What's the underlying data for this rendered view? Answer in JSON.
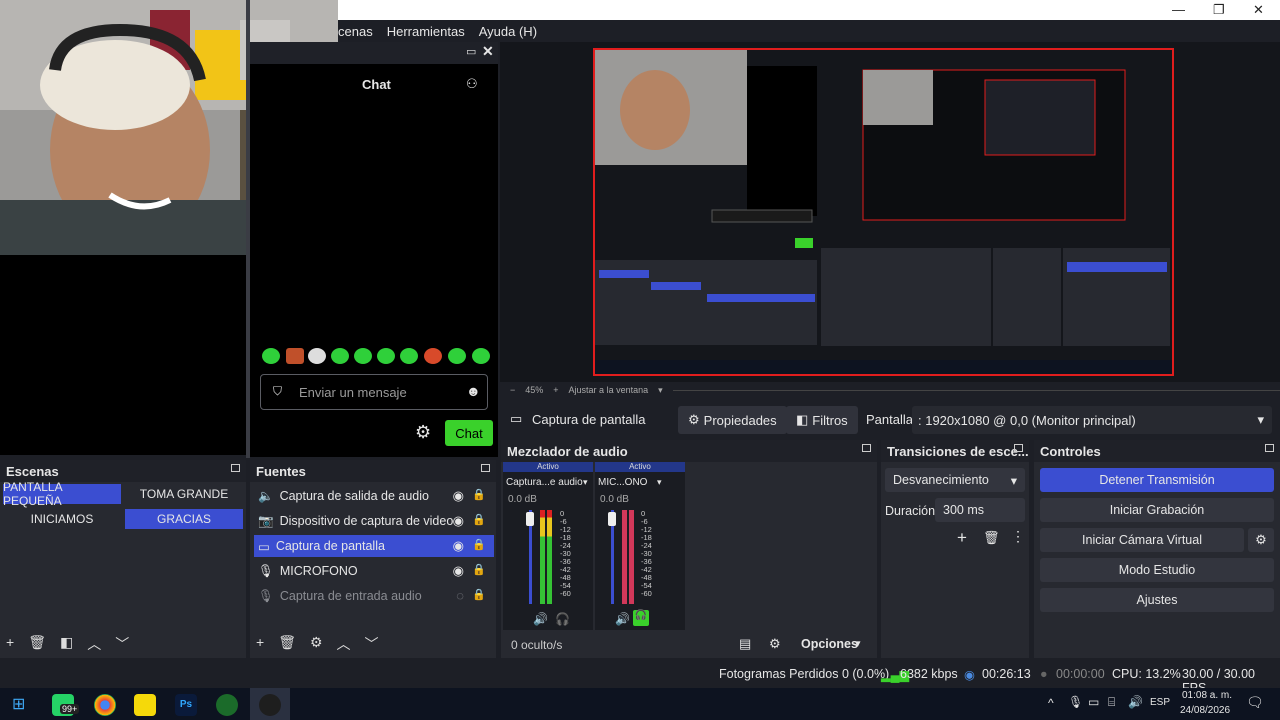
{
  "window": {
    "menu": [
      "cenas",
      "Herramientas",
      "Ayuda (H)"
    ],
    "controls": [
      "—",
      "❐",
      "✕"
    ]
  },
  "chat": {
    "title": "Chat",
    "placeholder": "Enviar un mensaje",
    "send_label": "Chat"
  },
  "preview": {
    "zoom_percent": "45%",
    "fit_label": "Ajustar a la ventana"
  },
  "source_toolbar": {
    "source_name": "Captura de pantalla",
    "properties_label": "Propiedades",
    "filters_label": "Filtros",
    "screen_label": "Pantalla",
    "screen_value": ": 1920x1080 @ 0,0 (Monitor principal)"
  },
  "scenes": {
    "title": "Escenas",
    "items": [
      {
        "label": "PANTALLA PEQUEÑA",
        "selected": true
      },
      {
        "label": "TOMA GRANDE",
        "selected": false
      },
      {
        "label": "INICIAMOS",
        "selected": false
      },
      {
        "label": "GRACIAS",
        "selected": true
      }
    ]
  },
  "sources": {
    "title": "Fuentes",
    "items": [
      {
        "label": "Captura de salida de audio",
        "icon": "speaker-icon"
      },
      {
        "label": "Dispositivo de captura de video",
        "icon": "camera-icon"
      },
      {
        "label": "Captura de pantalla",
        "icon": "monitor-icon",
        "selected": true
      },
      {
        "label": "MICROFONO",
        "icon": "mic-icon"
      },
      {
        "label": "Captura de entrada audio",
        "icon": "mic-icon",
        "disabled": true
      }
    ]
  },
  "mixer": {
    "title": "Mezclador de audio",
    "channels": [
      {
        "status": "Activo",
        "name": "Captura...e audio",
        "db": "0.0 dB"
      },
      {
        "status": "Activo",
        "name": "MIC...ONO",
        "db": "0.0 dB"
      }
    ],
    "scale": [
      "0",
      "-6",
      "-12",
      "-18",
      "-24",
      "-30",
      "-36",
      "-42",
      "-48",
      "-54",
      "-60"
    ],
    "hidden_count": "0 oculto/s",
    "options_label": "Opciones"
  },
  "transitions": {
    "title": "Transiciones de esce...",
    "selected": "Desvanecimiento",
    "duration_label": "Duración",
    "duration_value": "300 ms"
  },
  "controls": {
    "title": "Controles",
    "stop_stream": "Detener Transmisión",
    "start_recording": "Iniciar Grabación",
    "virtual_camera": "Iniciar Cámara Virtual",
    "studio_mode": "Modo Estudio",
    "settings": "Ajustes"
  },
  "status": {
    "dropped_frames": "Fotogramas Perdidos 0 (0.0%)",
    "bitrate": "6382 kbps",
    "stream_time": "00:26:13",
    "record_time": "00:00:00",
    "cpu": "CPU: 13.2%",
    "fps": "30.00 / 30.00 FPS"
  },
  "taskbar": {
    "badge": "99+",
    "language": "ESP",
    "time": "01:08 a. m.",
    "date": "24/08/2026"
  },
  "colors": {
    "accent": "#3b4ed1",
    "chat_green": "#3ad12b",
    "preview_border": "#e01d1d"
  }
}
